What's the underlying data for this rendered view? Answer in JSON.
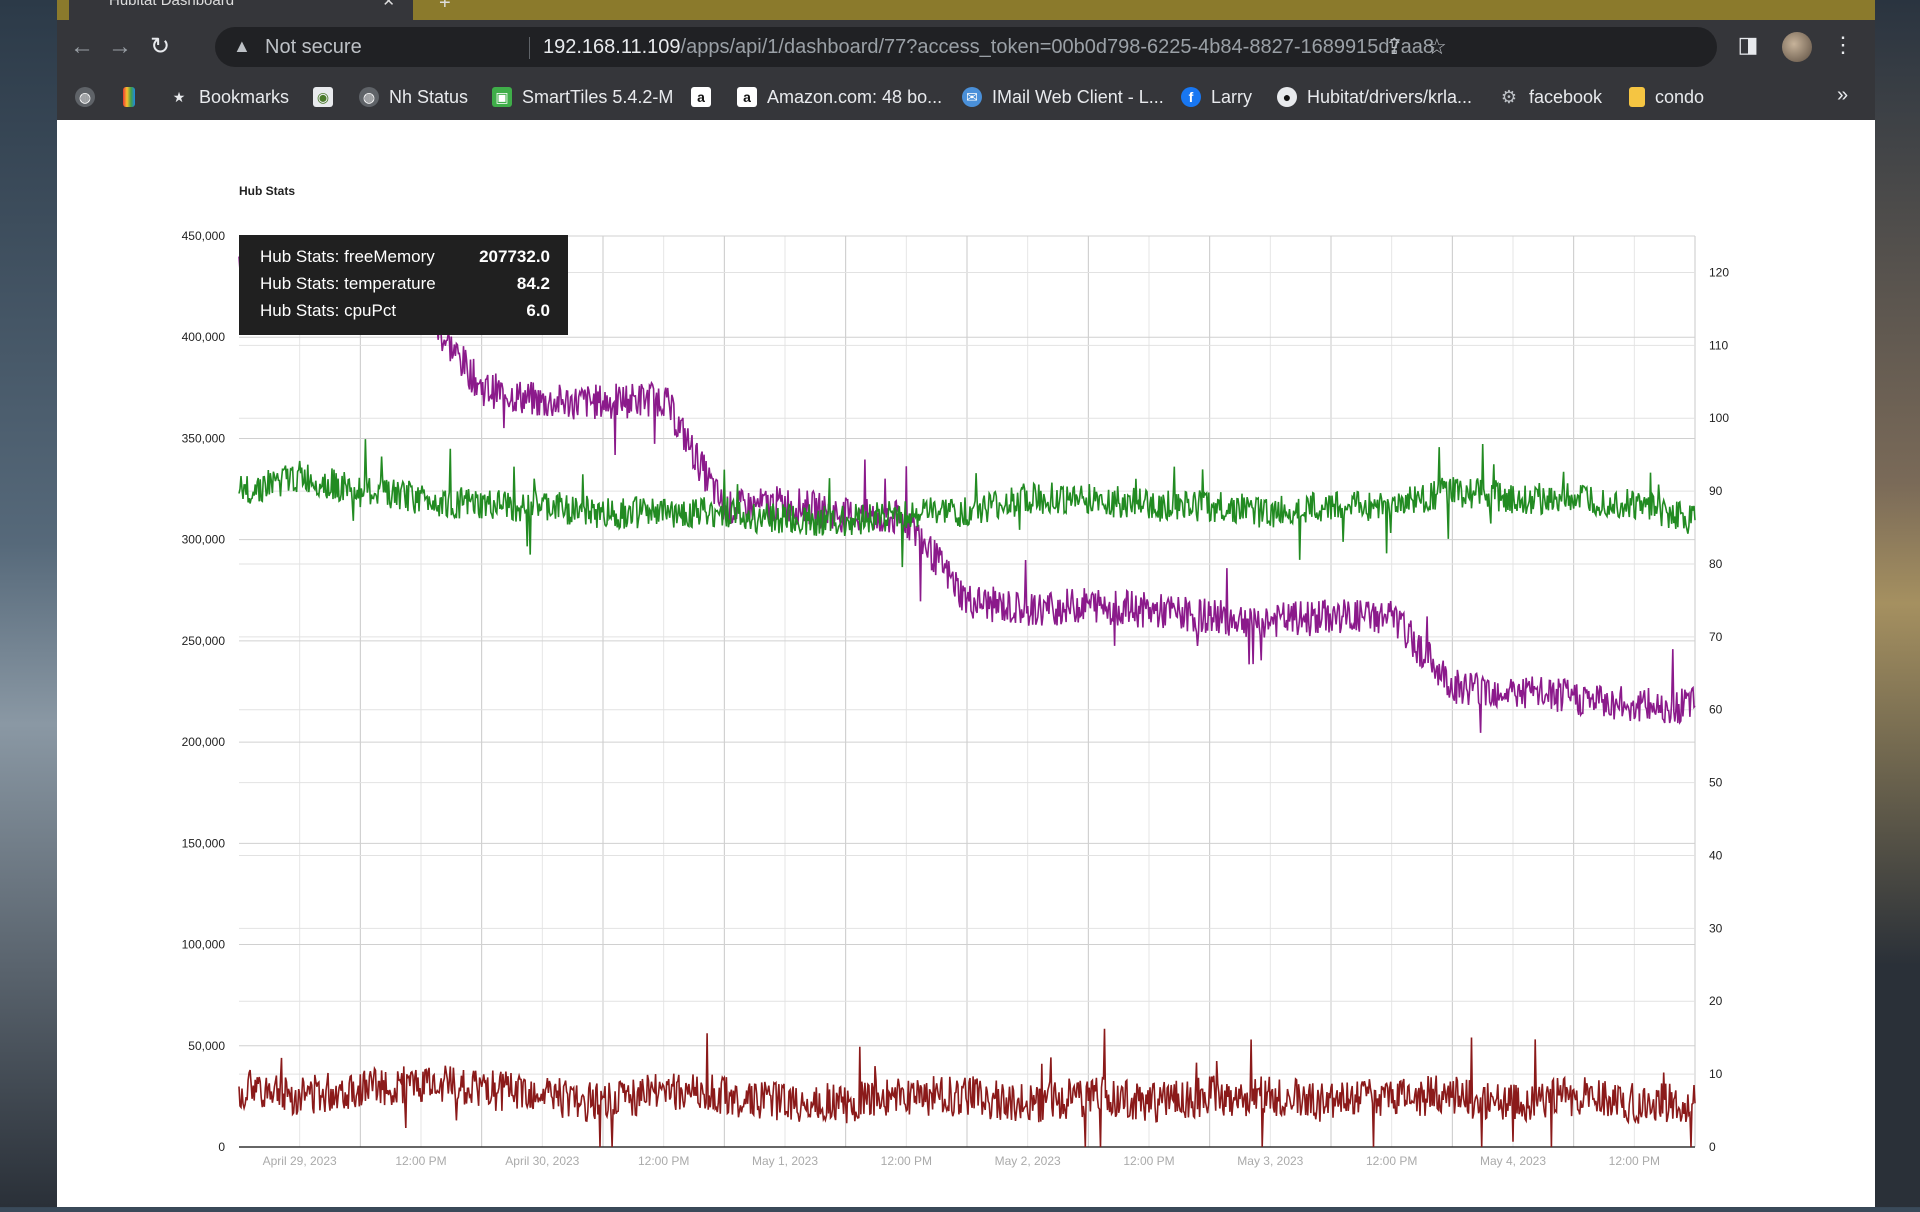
{
  "browser": {
    "tab_title": "Hubitat Dashboard",
    "new_tab": "+",
    "close": "✕",
    "not_secure": "Not secure",
    "url_host": "192.168.11.109",
    "url_path": "/apps/api/1/dashboard/77?access_token=00b0d798-6225-4b84-8827-1689915d7aa8",
    "bookmarks": [
      {
        "icon": "globe-icon",
        "label": ""
      },
      {
        "icon": "colorful-icon",
        "label": ""
      },
      {
        "icon": "star-icon",
        "label": "Bookmarks"
      },
      {
        "icon": "hubitat-icon",
        "label": ""
      },
      {
        "icon": "globe-icon",
        "label": "Nh Status"
      },
      {
        "icon": "smarttiles-icon",
        "label": "SmartTiles 5.4.2-M"
      },
      {
        "icon": "amazon-icon",
        "label": ""
      },
      {
        "icon": "amazon-icon",
        "label": "Amazon.com: 48 bo..."
      },
      {
        "icon": "imail-icon",
        "label": "IMail Web Client - L..."
      },
      {
        "icon": "facebook-icon",
        "label": "Larry"
      },
      {
        "icon": "github-icon",
        "label": "Hubitat/drivers/krla..."
      },
      {
        "icon": "gear-icon",
        "label": "facebook"
      },
      {
        "icon": "folder-icon",
        "label": "condo"
      }
    ],
    "more": "»"
  },
  "tooltip": {
    "rows": [
      {
        "label": "Hub Stats: freeMemory",
        "value": "207732.0"
      },
      {
        "label": "Hub Stats: temperature",
        "value": "84.2"
      },
      {
        "label": "Hub Stats: cpuPct",
        "value": "6.0"
      }
    ]
  },
  "chart_data": {
    "type": "line",
    "title": "Hub Stats",
    "x_tick_labels": [
      "April 29, 2023",
      "12:00 PM",
      "April 30, 2023",
      "12:00 PM",
      "May 1, 2023",
      "12:00 PM",
      "May 2, 2023",
      "12:00 PM",
      "May 3, 2023",
      "12:00 PM",
      "May 4, 2023",
      "12:00 PM"
    ],
    "xlim": [
      "2023-04-28 12:00",
      "2023-05-04 12:00"
    ],
    "ylim_left": [
      0,
      450000
    ],
    "yticks_left": [
      "0",
      "50,000",
      "100,000",
      "150,000",
      "200,000",
      "250,000",
      "300,000",
      "350,000",
      "400,000",
      "450,000"
    ],
    "ylim_right": [
      0,
      125
    ],
    "yticks_right": [
      "0",
      "10",
      "20",
      "30",
      "40",
      "50",
      "60",
      "70",
      "80",
      "90",
      "100",
      "110",
      "120"
    ],
    "grid": true,
    "series": [
      {
        "name": "freeMemory",
        "axis": "left",
        "color": "#8b1a8b",
        "x": [
          "2023-04-28 12:00",
          "2023-04-28 18:00",
          "2023-04-29 00:00",
          "2023-04-29 06:00",
          "2023-04-29 12:00",
          "2023-04-29 18:00",
          "2023-04-30 00:00",
          "2023-04-30 06:00",
          "2023-04-30 12:00",
          "2023-04-30 18:00",
          "2023-05-01 00:00",
          "2023-05-01 06:00",
          "2023-05-01 12:00",
          "2023-05-01 18:00",
          "2023-05-02 00:00",
          "2023-05-02 06:00",
          "2023-05-02 12:00",
          "2023-05-02 18:00",
          "2023-05-03 00:00",
          "2023-05-03 06:00",
          "2023-05-03 12:00",
          "2023-05-03 18:00",
          "2023-05-04 00:00",
          "2023-05-04 06:00",
          "2023-05-04 12:00"
        ],
        "y": [
          440000,
          425000,
          420000,
          415000,
          375000,
          368000,
          368000,
          370000,
          315000,
          318000,
          312000,
          310000,
          270000,
          265000,
          268000,
          265000,
          262000,
          260000,
          262000,
          262000,
          228000,
          225000,
          222000,
          218000,
          218000
        ]
      },
      {
        "name": "temperature",
        "axis": "right",
        "color": "#228b22",
        "x": [
          "2023-04-28 12:00",
          "2023-04-28 18:00",
          "2023-04-29 00:00",
          "2023-04-29 06:00",
          "2023-04-29 12:00",
          "2023-04-29 18:00",
          "2023-04-30 00:00",
          "2023-04-30 06:00",
          "2023-04-30 12:00",
          "2023-04-30 18:00",
          "2023-05-01 00:00",
          "2023-05-01 06:00",
          "2023-05-01 12:00",
          "2023-05-01 18:00",
          "2023-05-02 00:00",
          "2023-05-02 06:00",
          "2023-05-02 12:00",
          "2023-05-02 18:00",
          "2023-05-03 00:00",
          "2023-05-03 06:00",
          "2023-05-03 12:00",
          "2023-05-03 18:00",
          "2023-05-04 00:00",
          "2023-05-04 06:00",
          "2023-05-04 12:00"
        ],
        "y": [
          90,
          92,
          90,
          89,
          88,
          88,
          87,
          87,
          87,
          86,
          86,
          87,
          87,
          89,
          89,
          88,
          88,
          87,
          88,
          88,
          90,
          89,
          89,
          88,
          86
        ]
      },
      {
        "name": "cpuPct",
        "axis": "right",
        "color": "#8b1a1a",
        "x": [
          "2023-04-28 12:00",
          "2023-04-28 18:00",
          "2023-04-29 00:00",
          "2023-04-29 06:00",
          "2023-04-29 12:00",
          "2023-04-29 18:00",
          "2023-04-30 00:00",
          "2023-04-30 06:00",
          "2023-04-30 12:00",
          "2023-04-30 18:00",
          "2023-05-01 00:00",
          "2023-05-01 06:00",
          "2023-05-01 12:00",
          "2023-05-01 18:00",
          "2023-05-02 00:00",
          "2023-05-02 06:00",
          "2023-05-02 12:00",
          "2023-05-02 18:00",
          "2023-05-03 00:00",
          "2023-05-03 06:00",
          "2023-05-03 12:00",
          "2023-05-03 18:00",
          "2023-05-04 00:00",
          "2023-05-04 06:00",
          "2023-05-04 12:00"
        ],
        "y": [
          8,
          7,
          8,
          9,
          8,
          7,
          6,
          8,
          7,
          6,
          6,
          7,
          7,
          6,
          7,
          6,
          7,
          7,
          6,
          7,
          7,
          6,
          7,
          6,
          6
        ]
      }
    ]
  }
}
